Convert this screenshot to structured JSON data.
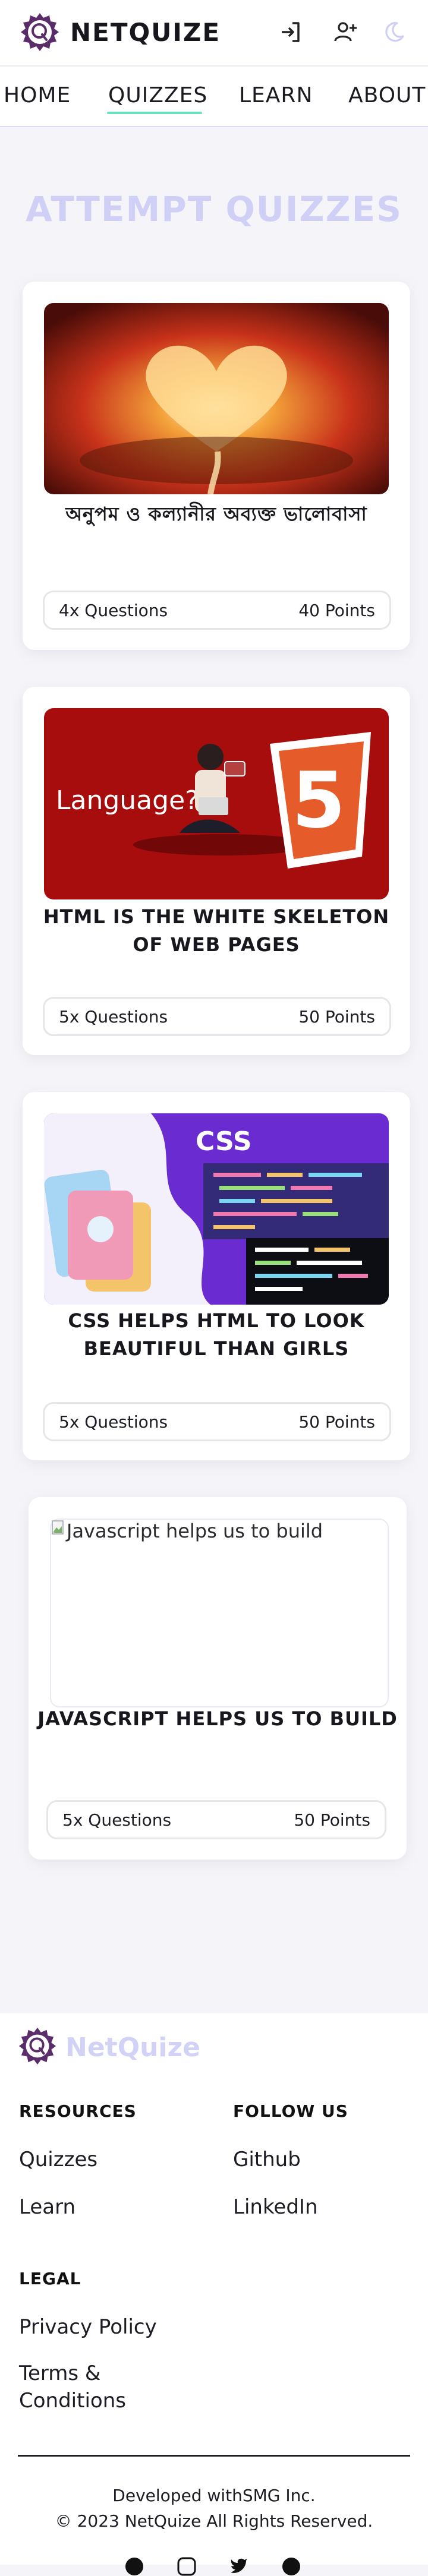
{
  "brand": {
    "name": "NETQUIZE",
    "footer_name": "NetQuize"
  },
  "header": {
    "icons": [
      "login-icon",
      "add-user-icon",
      "moon-icon"
    ]
  },
  "nav": {
    "items": [
      {
        "label": "HOME"
      },
      {
        "label": "QUIZZES"
      },
      {
        "label": "LEARN"
      },
      {
        "label": "ABOUT"
      }
    ],
    "active": "QUIZZES"
  },
  "page": {
    "title": "ATTEMPT QUIZZES"
  },
  "quizzes": [
    {
      "title": "অনুপম ও কল্যানীর অব্যক্ত ভালোবাসা",
      "questions": "4x Questions",
      "points": "40 Points",
      "image": "heart-clouds-sunset"
    },
    {
      "title": "HTML IS THE WHITE SKELETON OF WEB PAGES",
      "questions": "5x Questions",
      "points": "50 Points",
      "image": "html5-language"
    },
    {
      "title": "CSS HELPS HTML TO LOOK BEAUTIFUL THAN GIRLS",
      "questions": "5x Questions",
      "points": "50 Points",
      "image": "css-code-illustration"
    },
    {
      "title": "JAVASCRIPT HELPS US TO BUILD",
      "questions": "5x Questions",
      "points": "50 Points",
      "image_alt": "Javascript helps us to build"
    }
  ],
  "images": {
    "html_text": "Language?",
    "html_badge": "5",
    "css_label": "CSS"
  },
  "footer": {
    "resources": {
      "heading": "RESOURCES",
      "links": [
        "Quizzes",
        "Learn"
      ]
    },
    "follow": {
      "heading": "FOLLOW US",
      "links": [
        "Github",
        "LinkedIn"
      ]
    },
    "legal": {
      "heading": "LEGAL",
      "links": [
        "Privacy Policy",
        "Terms & Conditions"
      ]
    },
    "developed": "Developed withSMG Inc.",
    "copyright": "© 2023 NetQuize  All Rights Reserved.",
    "social_icons": [
      "facebook-icon",
      "instagram-icon",
      "twitter-icon",
      "github-icon"
    ]
  },
  "colors": {
    "accent_underline": "#6de0c0",
    "title_lavender": "#d0d0f6",
    "logo_purple": "#5a2d6a",
    "html_red": "#a80d0d",
    "css_purple": "#6a2cd0"
  }
}
